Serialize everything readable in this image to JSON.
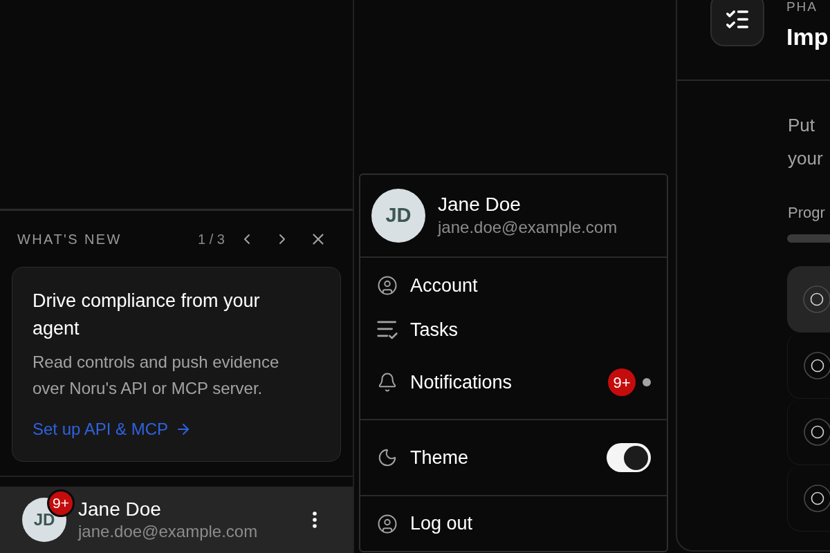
{
  "sidebar": {
    "whats_new": {
      "heading": "WHAT'S NEW",
      "pager": "1 / 3",
      "card": {
        "title": "Drive compliance from your agent",
        "body": "Read controls and push evidence over Noru's API or MCP server.",
        "link": "Set up API & MCP"
      }
    },
    "user": {
      "initials": "JD",
      "badge": "9+",
      "name": "Jane Doe",
      "email": "jane.doe@example.com",
      "selected": true
    }
  },
  "user_menu": {
    "initials": "JD",
    "name": "Jane Doe",
    "email": "jane.doe@example.com",
    "sections": [
      {
        "items": [
          {
            "kind": "account",
            "label": "Account"
          },
          {
            "kind": "tasks",
            "label": "Tasks"
          },
          {
            "kind": "notifications",
            "label": "Notifications",
            "badge": "9+",
            "unread": true
          }
        ]
      },
      {
        "items": [
          {
            "kind": "theme",
            "label": "Theme",
            "on": true
          }
        ]
      },
      {
        "items": [
          {
            "kind": "logout",
            "label": "Log out"
          }
        ]
      }
    ]
  },
  "main": {
    "header": {
      "overline": "PHA",
      "title": "Imp"
    },
    "description": [
      "Put",
      "your"
    ],
    "progress": {
      "label": "Progr"
    },
    "tasks": [
      {
        "selected": true
      },
      {
        "selected": false
      },
      {
        "selected": false
      },
      {
        "selected": false
      }
    ]
  }
}
